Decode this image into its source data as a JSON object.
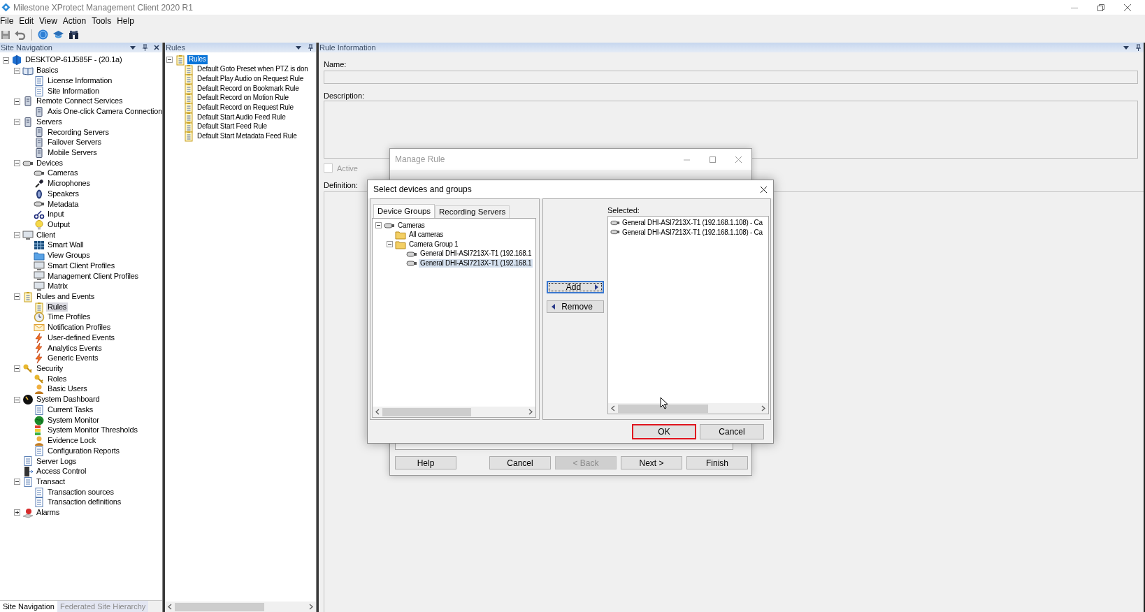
{
  "window": {
    "title": "Milestone XProtect Management Client 2020 R1"
  },
  "menu": [
    "File",
    "Edit",
    "View",
    "Action",
    "Tools",
    "Help"
  ],
  "site_navigation": {
    "title": "Site Navigation",
    "tree": [
      {
        "label": "DESKTOP-61J585F - (20.1a)",
        "expanded": true,
        "selected": false,
        "children": [
          {
            "label": "Basics",
            "expanded": true,
            "selected": false,
            "children": [
              {
                "label": "License Information",
                "selected": false
              },
              {
                "label": "Site Information",
                "selected": false
              }
            ]
          },
          {
            "label": "Remote Connect Services",
            "expanded": true,
            "selected": false,
            "children": [
              {
                "label": "Axis One-click Camera Connection",
                "selected": false
              }
            ]
          },
          {
            "label": "Servers",
            "expanded": true,
            "selected": false,
            "children": [
              {
                "label": "Recording Servers",
                "selected": false
              },
              {
                "label": "Failover Servers",
                "selected": false
              },
              {
                "label": "Mobile Servers",
                "selected": false
              }
            ]
          },
          {
            "label": "Devices",
            "expanded": true,
            "selected": false,
            "children": [
              {
                "label": "Cameras",
                "selected": false
              },
              {
                "label": "Microphones",
                "selected": false
              },
              {
                "label": "Speakers",
                "selected": false
              },
              {
                "label": "Metadata",
                "selected": false
              },
              {
                "label": "Input",
                "selected": false
              },
              {
                "label": "Output",
                "selected": false
              }
            ]
          },
          {
            "label": "Client",
            "expanded": true,
            "selected": false,
            "children": [
              {
                "label": "Smart Wall",
                "selected": false
              },
              {
                "label": "View Groups",
                "selected": false
              },
              {
                "label": "Smart Client Profiles",
                "selected": false
              },
              {
                "label": "Management Client Profiles",
                "selected": false
              },
              {
                "label": "Matrix",
                "selected": false
              }
            ]
          },
          {
            "label": "Rules and Events",
            "expanded": true,
            "selected": false,
            "children": [
              {
                "label": "Rules",
                "selected": true
              },
              {
                "label": "Time Profiles",
                "selected": false
              },
              {
                "label": "Notification Profiles",
                "selected": false
              },
              {
                "label": "User-defined Events",
                "selected": false
              },
              {
                "label": "Analytics Events",
                "selected": false
              },
              {
                "label": "Generic Events",
                "selected": false
              }
            ]
          },
          {
            "label": "Security",
            "expanded": true,
            "selected": false,
            "children": [
              {
                "label": "Roles",
                "selected": false
              },
              {
                "label": "Basic Users",
                "selected": false
              }
            ]
          },
          {
            "label": "System Dashboard",
            "expanded": true,
            "selected": false,
            "children": [
              {
                "label": "Current Tasks",
                "selected": false
              },
              {
                "label": "System Monitor",
                "selected": false
              },
              {
                "label": "System Monitor Thresholds",
                "selected": false
              },
              {
                "label": "Evidence Lock",
                "selected": false
              },
              {
                "label": "Configuration Reports",
                "selected": false
              }
            ]
          },
          {
            "label": "Server Logs",
            "selected": false
          },
          {
            "label": "Access Control",
            "selected": false
          },
          {
            "label": "Transact",
            "expanded": true,
            "selected": false,
            "children": [
              {
                "label": "Transaction sources",
                "selected": false
              },
              {
                "label": "Transaction definitions",
                "selected": false
              }
            ]
          },
          {
            "label": "Alarms",
            "expanded": false,
            "selected": false
          }
        ]
      }
    ]
  },
  "bottom_tabs": [
    {
      "label": "Site Navigation",
      "selected": true
    },
    {
      "label": "Federated Site Hierarchy",
      "selected": false
    }
  ],
  "rules_pane": {
    "title": "Rules",
    "tree": [
      {
        "label": "Rules",
        "expanded": true,
        "selected": true,
        "children": [
          {
            "label": "Default Goto Preset when PTZ is don",
            "selected": false
          },
          {
            "label": "Default Play Audio on Request Rule",
            "selected": false
          },
          {
            "label": "Default Record on Bookmark Rule",
            "selected": false
          },
          {
            "label": "Default Record on Motion Rule",
            "selected": false
          },
          {
            "label": "Default Record on Request Rule",
            "selected": false
          },
          {
            "label": "Default Start Audio Feed Rule",
            "selected": false
          },
          {
            "label": "Default Start Feed Rule",
            "selected": false
          },
          {
            "label": "Default Start Metadata Feed Rule",
            "selected": false
          }
        ]
      }
    ]
  },
  "rule_information": {
    "title": "Rule Information",
    "name_label": "Name:",
    "description_label": "Description:",
    "active": {
      "label": "Active",
      "checked": false,
      "disabled": true
    },
    "definition_label": "Definition:"
  },
  "manage_rule": {
    "title": "Manage Rule",
    "buttons": [
      {
        "label": "Help",
        "disabled": false
      },
      {
        "label": "Cancel",
        "disabled": false
      },
      {
        "label": "< Back",
        "disabled": true
      },
      {
        "label": "Next >",
        "disabled": false
      },
      {
        "label": "Finish",
        "disabled": false
      }
    ]
  },
  "select_dialog": {
    "title": "Select devices and groups",
    "tabs": [
      {
        "label": "Device Groups",
        "selected": true
      },
      {
        "label": "Recording Servers",
        "selected": false
      }
    ],
    "tree": [
      {
        "label": "Cameras",
        "expanded": true,
        "selected": false,
        "children": [
          {
            "label": "All cameras",
            "selected": false
          },
          {
            "label": "Camera Group 1",
            "expanded": true,
            "selected": false,
            "children": [
              {
                "label": "General DHI-ASI7213X-T1 (192.168.1",
                "selected": false
              },
              {
                "label": "General DHI-ASI7213X-T1 (192.168.1",
                "selected": true
              }
            ]
          }
        ]
      }
    ],
    "transfer_buttons": [
      {
        "kind": "add",
        "label": "Add",
        "focused": true
      },
      {
        "kind": "remove",
        "label": "Remove",
        "focused": false
      }
    ],
    "selected_label": "Selected:",
    "selected_items": [
      {
        "label": "General DHI-ASI7213X-T1 (192.168.1.108) - Ca",
        "selected": false
      },
      {
        "label": "General DHI-ASI7213X-T1 (192.168.1.108) - Ca",
        "selected": false
      }
    ],
    "buttons": [
      {
        "label": "OK",
        "highlighted": true
      },
      {
        "label": "Cancel",
        "highlighted": false
      }
    ]
  }
}
